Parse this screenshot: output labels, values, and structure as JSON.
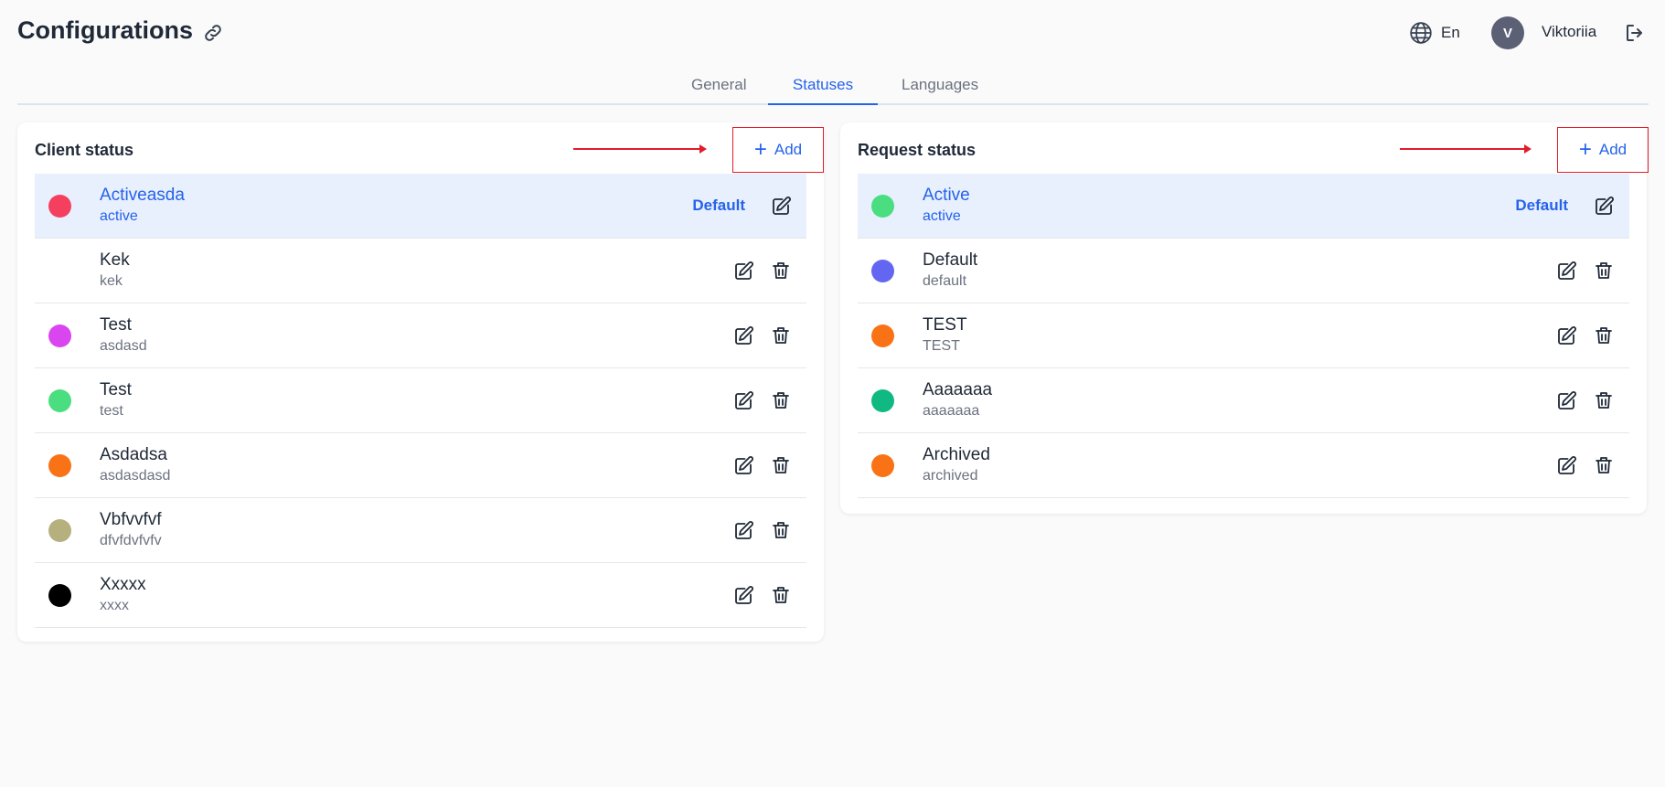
{
  "header": {
    "title": "Configurations",
    "language": "En",
    "avatar_initial": "V",
    "user_name": "Viktoriia"
  },
  "tabs": [
    {
      "label": "General",
      "active": false
    },
    {
      "label": "Statuses",
      "active": true
    },
    {
      "label": "Languages",
      "active": false
    }
  ],
  "client_status": {
    "title": "Client status",
    "add_label": "Add",
    "default_label": "Default",
    "items": [
      {
        "name": "Activeasda",
        "code": "active",
        "color": "#f43f5e",
        "is_default": true
      },
      {
        "name": "Kek",
        "code": "kek",
        "color": "#ffffff",
        "is_default": false
      },
      {
        "name": "Test",
        "code": "asdasd",
        "color": "#d946ef",
        "is_default": false
      },
      {
        "name": "Test",
        "code": "test",
        "color": "#4ade80",
        "is_default": false
      },
      {
        "name": "Asdadsa",
        "code": "asdasdasd",
        "color": "#f97316",
        "is_default": false
      },
      {
        "name": "Vbfvvfvf",
        "code": "dfvfdvfvfv",
        "color": "#b5b07e",
        "is_default": false
      },
      {
        "name": "Xxxxx",
        "code": "xxxx",
        "color": "#000000",
        "is_default": false
      }
    ]
  },
  "request_status": {
    "title": "Request status",
    "add_label": "Add",
    "default_label": "Default",
    "items": [
      {
        "name": "Active",
        "code": "active",
        "color": "#4ade80",
        "is_default": true
      },
      {
        "name": "Default",
        "code": "default",
        "color": "#6366f1",
        "is_default": false
      },
      {
        "name": "TEST",
        "code": "TEST",
        "color": "#f97316",
        "is_default": false
      },
      {
        "name": "Aaaaaaa",
        "code": "aaaaaaa",
        "color": "#10b981",
        "is_default": false
      },
      {
        "name": "Archived",
        "code": "archived",
        "color": "#f97316",
        "is_default": false
      }
    ]
  },
  "colors": {
    "accent": "#2563eb",
    "highlight": "#e11d2a",
    "default_row_bg": "#e8effd"
  }
}
